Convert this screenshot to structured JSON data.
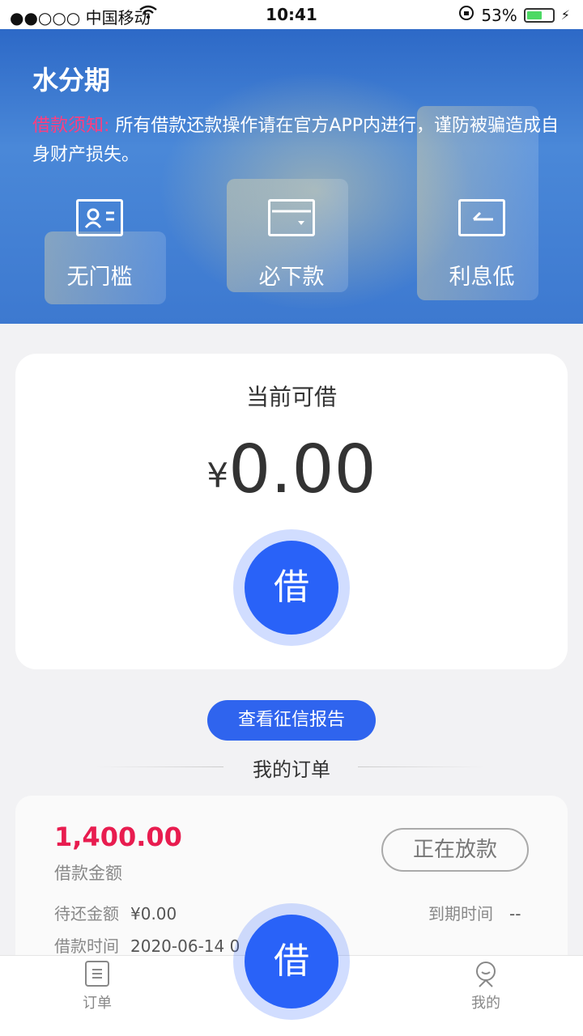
{
  "status_bar": {
    "carrier": "●●○○○ 中国移动",
    "time": "10:41",
    "battery": "53%"
  },
  "header": {
    "title": "水分期",
    "notice_label": "借款须知:",
    "notice_text": "所有借款还款操作请在官方APP内进行，谨防被骗造成自身财产损失。",
    "features": [
      {
        "label": "无门槛",
        "icon": "id-card-icon"
      },
      {
        "label": "必下款",
        "icon": "wallet-icon"
      },
      {
        "label": "利息低",
        "icon": "return-icon"
      }
    ]
  },
  "loan_card": {
    "heading": "当前可借",
    "currency": "¥",
    "amount": "0.00",
    "button_label": "借"
  },
  "report_button": "查看征信报告",
  "orders": {
    "heading": "我的订单",
    "items": [
      {
        "amount": "1,400.00",
        "amount_label": "借款金额",
        "status": "正在放款",
        "pending_label": "待还金额",
        "pending_value": "¥0.00",
        "due_label": "到期时间",
        "due_value": "--",
        "time_label": "借款时间",
        "time_value": "2020-06-14 0"
      }
    ]
  },
  "tabbar": {
    "orders": "订单",
    "borrow": "借",
    "mine": "我的"
  }
}
